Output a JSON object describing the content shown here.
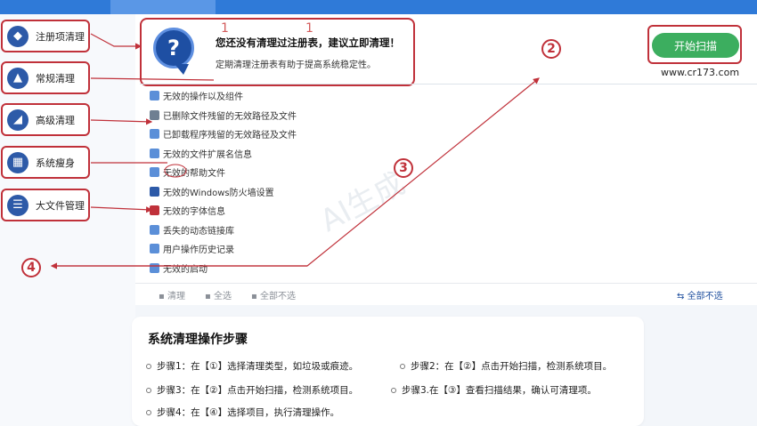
{
  "sidebar": {
    "items": [
      {
        "label": "注册项清理",
        "icon": "diamond-grid-icon"
      },
      {
        "label": "常规清理",
        "icon": "broom-icon"
      },
      {
        "label": "高级清理",
        "icon": "eraser-icon"
      },
      {
        "label": "系统瘦身",
        "icon": "windows-icon"
      },
      {
        "label": "大文件管理",
        "icon": "list-icon"
      }
    ]
  },
  "alert": {
    "title": "您还没有清理过注册表，建议立即清理！",
    "subtitle": "定期清理注册表有助于提高系统稳定性。",
    "icon": "question-bubble-icon",
    "marker": "1"
  },
  "scan": {
    "button_label": "开始扫描",
    "site": "www.cr173.com"
  },
  "list": {
    "items": [
      {
        "label": "无效的操作以及组件",
        "icon": "component-icon",
        "color": "#5b8fd8"
      },
      {
        "label": "已删除文件残留的无效路径及文件",
        "icon": "folder-icon",
        "color": "#6f7f92"
      },
      {
        "label": "已卸载程序残留的无效路径及文件",
        "icon": "uninstall-icon",
        "color": "#5b8fd8"
      },
      {
        "label": "无效的文件扩展名信息",
        "icon": "file-icon",
        "color": "#5b8fd8"
      },
      {
        "label": "无效的帮助文件",
        "icon": "help-file-icon",
        "color": "#5b8fd8"
      },
      {
        "label": "无效的Windows防火墙设置",
        "icon": "shield-icon",
        "color": "#2d5aa8"
      },
      {
        "label": "无效的字体信息",
        "icon": "font-icon",
        "color": "#c0313a"
      },
      {
        "label": "丢失的动态链接库",
        "icon": "dll-icon",
        "color": "#5b8fd8"
      },
      {
        "label": "用户操作历史记录",
        "icon": "history-icon",
        "color": "#5b8fd8"
      },
      {
        "label": "无效的启动",
        "icon": "startup-icon",
        "color": "#5b8fd8"
      }
    ]
  },
  "bottom_bar": {
    "clean": "清理",
    "select_all": "全选",
    "select_none": "全部不选",
    "right": "全部不选"
  },
  "markers": {
    "m2": "2",
    "m3": "3",
    "m4": "4"
  },
  "watermark": "AI生成",
  "steps": {
    "title": "系统清理操作步骤",
    "items": [
      "步骤1：在【①】选择清理类型，如垃圾或痕迹。",
      "步骤2：在【②】点击开始扫描，检测系统项目。",
      "步骤3：在【②】点击开始扫描，检测系统项目。",
      "步骤3.在【③】查看扫描结果，确认可清理项。",
      "步骤4：在【④】选择项目，执行清理操作。"
    ]
  }
}
